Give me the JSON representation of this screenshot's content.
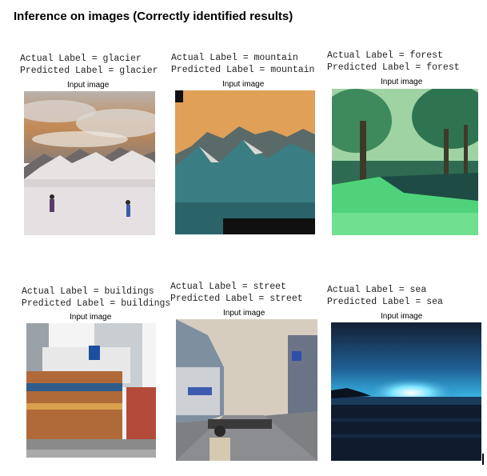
{
  "title": "Inference on images (Correctly identified results)",
  "panels": [
    {
      "actual": "Actual Label = glacier",
      "predicted": "Predicted Label = glacier",
      "caption": "Input image",
      "scene": "glacier"
    },
    {
      "actual": "Actual Label = mountain",
      "predicted": "Predicted Label = mountain",
      "caption": "Input image",
      "scene": "mountain"
    },
    {
      "actual": "Actual Label = forest",
      "predicted": "Predicted Label = forest",
      "caption": "Input image",
      "scene": "forest"
    },
    {
      "actual": "Actual Label = buildings",
      "predicted": "Predicted Label = buildings",
      "caption": "Input image",
      "scene": "buildings"
    },
    {
      "actual": "Actual Label = street",
      "predicted": "Predicted Label = street",
      "caption": "Input image",
      "scene": "street"
    },
    {
      "actual": "Actual Label = sea",
      "predicted": "Predicted Label = sea",
      "caption": "Input image",
      "scene": "sea"
    }
  ]
}
